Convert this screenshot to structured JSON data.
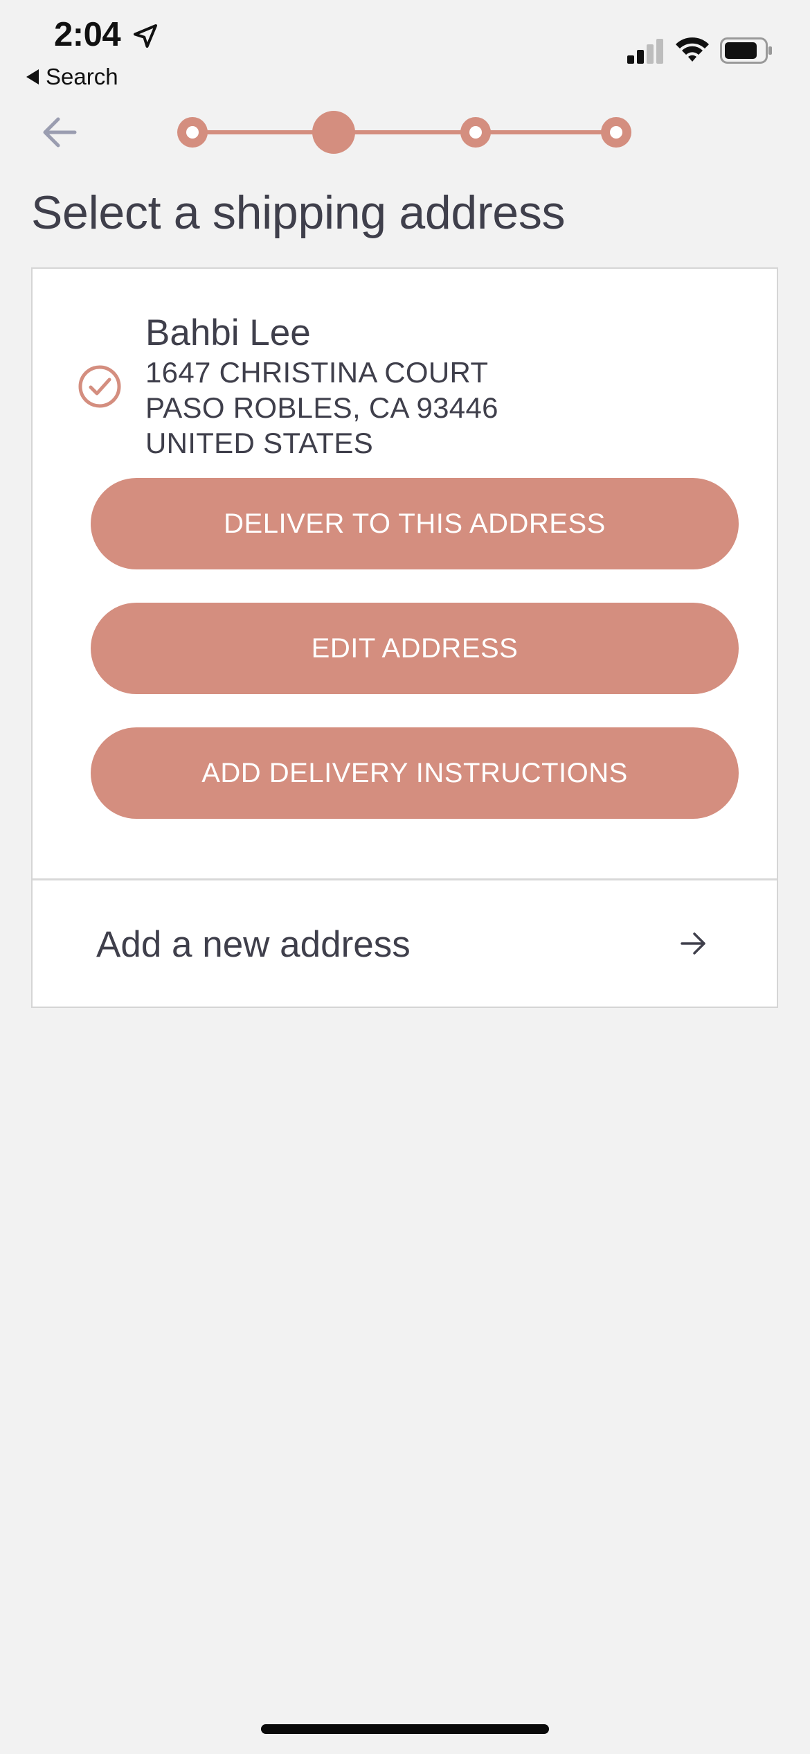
{
  "status_bar": {
    "time": "2:04",
    "back_app_label": "Search",
    "icons": [
      "location-arrow-icon",
      "cellular-signal-icon",
      "wifi-icon",
      "battery-icon"
    ]
  },
  "nav": {
    "back_icon": "arrow-left-icon",
    "progress": {
      "total_steps": 4,
      "current_step": 2
    }
  },
  "page": {
    "title": "Select a shipping address"
  },
  "address_card": {
    "selected_icon": "check-circle-icon",
    "name": "Bahbi Lee",
    "line1": "1647 CHRISTINA COURT",
    "line2": "PASO ROBLES, CA 93446",
    "line3": "UNITED STATES",
    "buttons": {
      "deliver": "DELIVER TO THIS ADDRESS",
      "edit": "EDIT ADDRESS",
      "instructions": "ADD DELIVERY INSTRUCTIONS"
    }
  },
  "add_new": {
    "label": "Add a new address",
    "icon": "arrow-right-icon"
  },
  "colors": {
    "accent": "#d48e7f",
    "background": "#f2f2f2",
    "text": "#3f3f4b",
    "muted_icon": "#9a9db0"
  }
}
